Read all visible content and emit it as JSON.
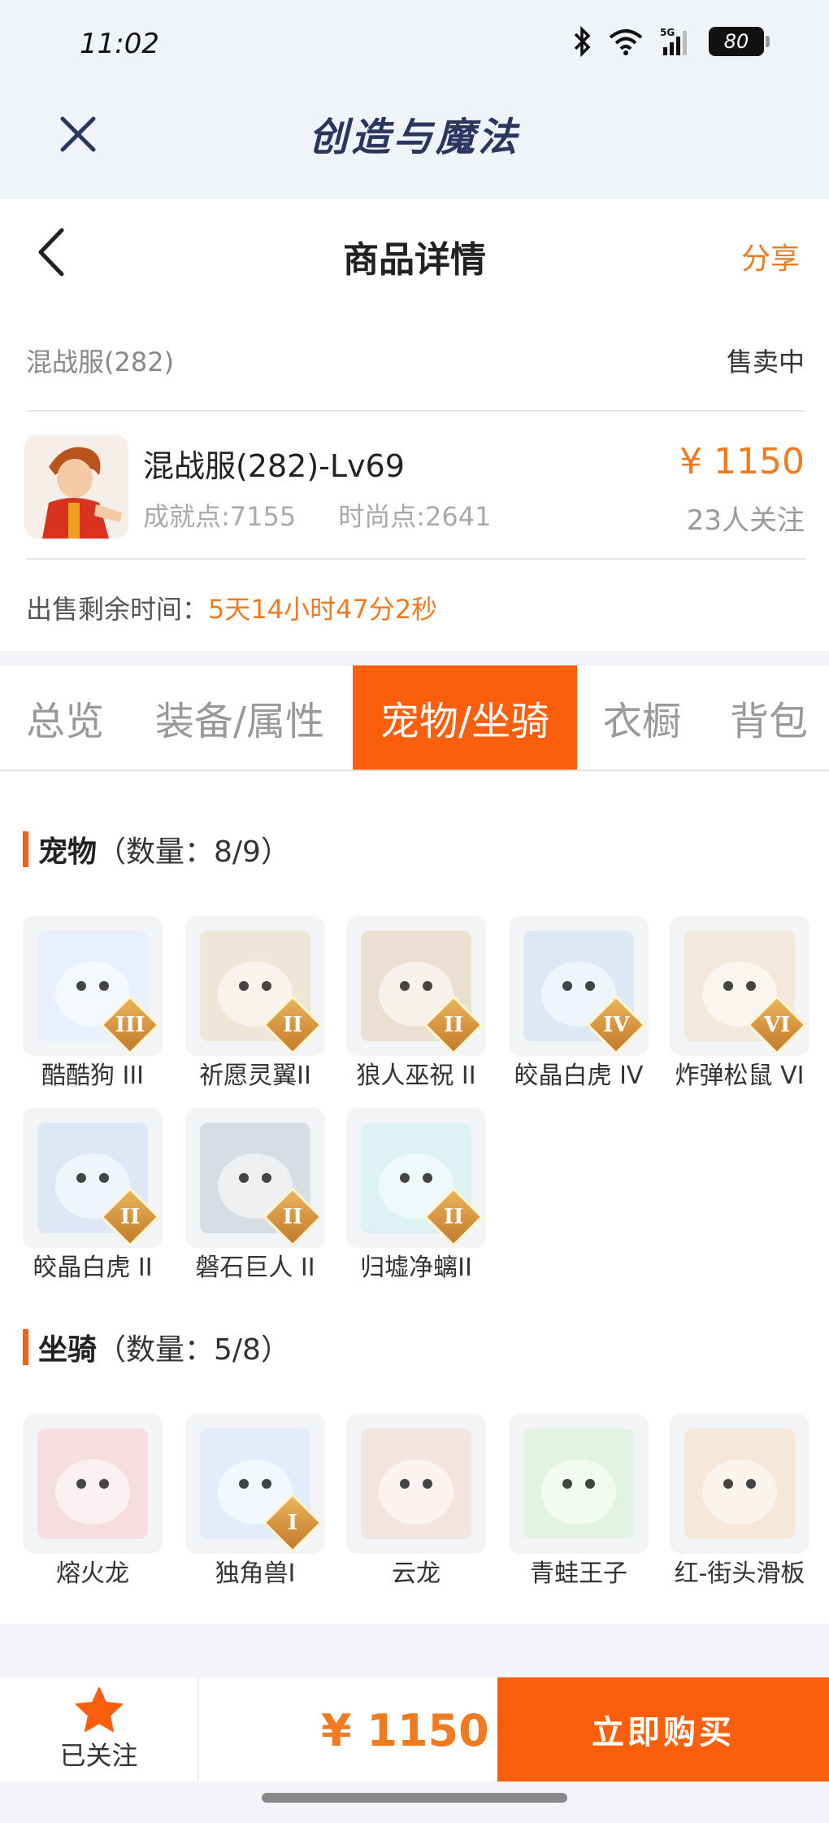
{
  "status_bar": {
    "time": "11:02",
    "battery": "80",
    "network": "5G"
  },
  "app": {
    "title": "创造与魔法"
  },
  "nav": {
    "title": "商品详情",
    "share": "分享"
  },
  "product": {
    "server": "混战服(282)",
    "status": "售卖中",
    "name": "混战服(282)-Lv69",
    "achievement": "成就点:7155",
    "fashion": "时尚点:2641",
    "price": "¥ 1150",
    "followers": "23人关注",
    "remaining_label": "出售剩余时间：",
    "remaining_value": "5天14小时47分2秒"
  },
  "tabs": [
    "总览",
    "装备/属性",
    "宠物/坐骑",
    "衣橱",
    "背包"
  ],
  "active_tab": "宠物/坐骑",
  "pets": {
    "title": "宠物",
    "count": "（数量：8/9）",
    "items": [
      {
        "name": "酷酷狗 III",
        "tier": "III",
        "color": "#e8f0ff"
      },
      {
        "name": "祈愿灵翼II",
        "tier": "II",
        "color": "#f0e6d8"
      },
      {
        "name": "狼人巫祝 II",
        "tier": "II",
        "color": "#eadfd0"
      },
      {
        "name": "皎晶白虎 IV",
        "tier": "IV",
        "color": "#dde7f6"
      },
      {
        "name": "炸弹松鼠 VI",
        "tier": "VI",
        "color": "#f2e8dc"
      },
      {
        "name": "皎晶白虎 II",
        "tier": "II",
        "color": "#dde7f6"
      },
      {
        "name": "磐石巨人 II",
        "tier": "II",
        "color": "#d9dde3"
      },
      {
        "name": "归墟净螭II",
        "tier": "II",
        "color": "#ddf2f2"
      }
    ]
  },
  "mounts": {
    "title": "坐骑",
    "count": "（数量：5/8）",
    "items": [
      {
        "name": "熔火龙",
        "tier": "",
        "color": "#f5dde2"
      },
      {
        "name": "独角兽I",
        "tier": "I",
        "color": "#e3ecfa"
      },
      {
        "name": "云龙",
        "tier": "",
        "color": "#f3e4e0"
      },
      {
        "name": "青蛙王子",
        "tier": "",
        "color": "#e2f3e2"
      },
      {
        "name": "红-街头滑板",
        "tier": "",
        "color": "#f6e7d8"
      }
    ]
  },
  "bottom": {
    "follow_label": "已关注",
    "price": "¥ 1150",
    "buy_label": "立即购买"
  }
}
